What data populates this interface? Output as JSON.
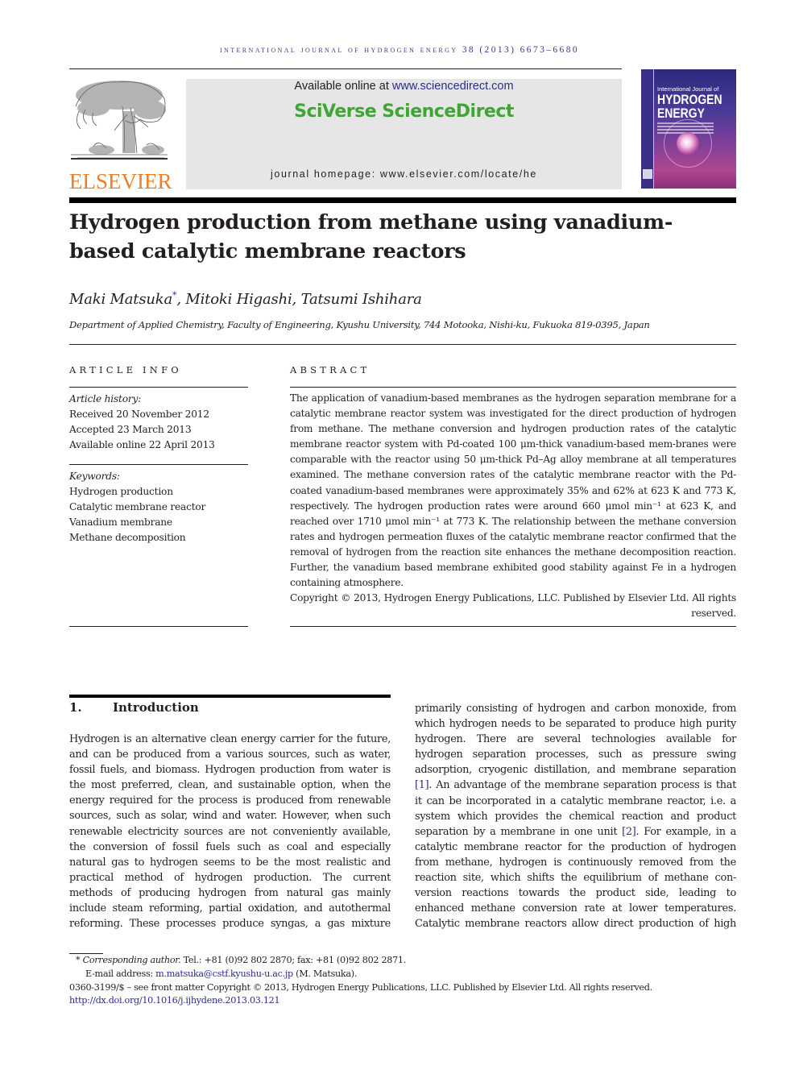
{
  "running_header": "International Journal of Hydrogen Energy 38 (2013) 6673–6680",
  "publisher": {
    "logo_word": "ELSEVIER",
    "available_prefix": "Available online at ",
    "available_link": "www.sciencedirect.com",
    "sciverse": "SciVerse ScienceDirect",
    "homepage": "journal homepage: www.elsevier.com/locate/he",
    "cover_small": "International Journal of",
    "cover_big_1": "HYDROGEN",
    "cover_big_2": "ENERGY",
    "colors": {
      "elsevier_orange": "#f07e26",
      "sciverse_green": "#3fa535",
      "link_blue": "#2b2d8f",
      "box_gray": "#e6e6e6"
    }
  },
  "article": {
    "title": "Hydrogen production from methane using vanadium-based catalytic membrane reactors",
    "authors": [
      {
        "name": "Maki Matsuka",
        "mark": "*"
      },
      {
        "name": "Mitoki Higashi",
        "mark": ""
      },
      {
        "name": "Tatsumi Ishihara",
        "mark": ""
      }
    ],
    "author_sep_1": ", ",
    "author_sep_2": ", ",
    "affiliation": "Department of Applied Chemistry, Faculty of Engineering, Kyushu University, 744 Motooka, Nishi-ku, Fukuoka 819-0395, Japan"
  },
  "article_info": {
    "label": "ARTICLE INFO",
    "history_label": "Article history:",
    "history": [
      "Received 20 November 2012",
      "Accepted 23 March 2013",
      "Available online 22 April 2013"
    ],
    "keywords_label": "Keywords:",
    "keywords": [
      "Hydrogen production",
      "Catalytic membrane reactor",
      "Vanadium membrane",
      "Methane decomposition"
    ]
  },
  "abstract": {
    "label": "ABSTRACT",
    "text": "The application of vanadium-based membranes as the hydrogen separation membrane for a catalytic membrane reactor system was investigated for the direct production of hydrogen from methane. The methane conversion and hydrogen production rates of the catalytic membrane reactor system with Pd-coated 100 μm-thick vanadium-based mem-branes were comparable with the reactor using 50 μm-thick Pd–Ag alloy membrane at all temperatures examined. The methane conversion rates of the catalytic membrane reactor with the Pd-coated vanadium-based membranes were approximately 35% and 62% at 623 K and 773 K, respectively. The hydrogen production rates were around 660  μmol min⁻¹ at 623 K, and reached over 1710  μmol min⁻¹ at 773 K. The relationship between the methane conversion rates and hydrogen permeation fluxes of the catalytic membrane reactor confirmed that the removal of hydrogen from the reaction site enhances the methane decomposition reaction. Further, the vanadium based membrane exhibited good stability against Fe in a hydrogen containing atmosphere.",
    "copyright": "Copyright © 2013, Hydrogen Energy Publications, LLC. Published by Elsevier Ltd. All rights reserved."
  },
  "section1": {
    "number": "1.",
    "heading": "Introduction",
    "left_lines": [
      "Hydrogen is an alternative clean energy carrier for the future,",
      "and can be produced from a various sources, such as water,",
      "fossil fuels, and biomass. Hydrogen production from water is",
      "the most preferred, clean, and sustainable option, when the",
      "energy required for the process is produced from renewable",
      "sources, such as solar, wind and water. However, when such",
      "renewable electricity sources are not conveniently available,",
      "the conversion of fossil fuels such as coal and especially",
      "natural gas to hydrogen seems to be the most realistic and",
      "practical method of hydrogen production. The current",
      "methods of producing hydrogen from natural gas mainly",
      "include steam reforming, partial oxidation, and autothermal",
      "reforming. These processes produce syngas, a gas mixture"
    ],
    "right_lines": [
      "primarily consisting of hydrogen and carbon monoxide, from",
      "which hydrogen needs to be separated to produce high purity",
      "hydrogen. There are several technologies available for",
      "hydrogen separation processes, such as pressure swing",
      "adsorption, cryogenic distillation, and membrane separation"
    ],
    "ref1": "[1]",
    "right_line6_rest": ". An advantage of the membrane separation process is that",
    "right_line7": "it can be incorporated in a catalytic membrane reactor, i.e. a",
    "right_line8": "system which provides the chemical reaction and product",
    "right_line9_pre": "separation by a membrane in one unit ",
    "ref2": "[2]",
    "right_line9_post": ". For example, in a",
    "right_lines_tail": [
      "catalytic membrane reactor for the production of hydrogen",
      "from methane, hydrogen is continuously removed from the",
      "reaction site, which shifts the equilibrium of methane con-",
      "version reactions towards the product side, leading to",
      "enhanced methane conversion rate at lower temperatures.",
      "Catalytic membrane reactors allow direct production of high"
    ]
  },
  "footnotes": {
    "mark": "*",
    "corr_label": "Corresponding author.",
    "corr_contact": " Tel.: +81 (0)92 802 2870; fax: +81 (0)92 802 2871.",
    "email_label": "E-mail address: ",
    "email": "m.matsuka@cstf.kyushu-u.ac.jp",
    "email_owner": " (M. Matsuka).",
    "issn_line": "0360-3199/$ – see front matter Copyright © 2013, Hydrogen Energy Publications, LLC. Published by Elsevier Ltd. All rights reserved.",
    "doi": "http://dx.doi.org/10.1016/j.ijhydene.2013.03.121"
  }
}
